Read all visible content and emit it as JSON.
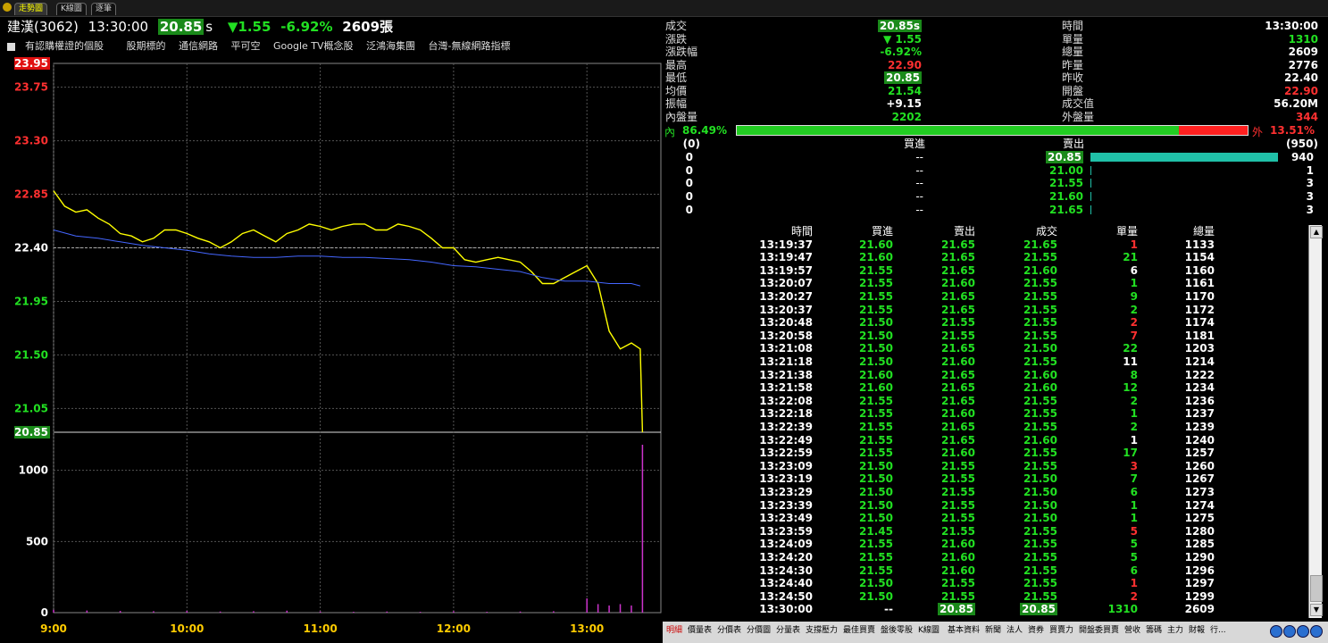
{
  "tabs": [
    "走勢圖",
    "K線圖",
    "逐筆"
  ],
  "header": {
    "stock_name": "建漢(3062)",
    "time": "13:30:00",
    "price": "20.85",
    "price_suffix": "s",
    "change": "▼1.55",
    "change_pct": "-6.92%",
    "volume": "2609張"
  },
  "concepts": [
    "有認購權證的個股",
    "股期標的",
    "通信網路",
    "平可空",
    "Google TV概念股",
    "泛鴻海集團",
    "台灣-無線網路指標"
  ],
  "chart_data": {
    "type": "line",
    "price_axis_ticks": [
      "23.95",
      "23.75",
      "23.30",
      "22.85",
      "22.40",
      "21.95",
      "21.50",
      "21.05",
      "20.85"
    ],
    "volume_axis_ticks": [
      "1000",
      "500",
      "0"
    ],
    "x_ticks": [
      "9:00",
      "10:00",
      "11:00",
      "12:00",
      "13:00"
    ],
    "ylim": [
      20.85,
      23.95
    ],
    "reference_price": 22.4,
    "current_price_line": 20.85,
    "series": [
      {
        "color": "#ffff00",
        "x": [
          "09:00",
          "09:05",
          "09:10",
          "09:15",
          "09:20",
          "09:25",
          "09:30",
          "09:35",
          "09:40",
          "09:45",
          "09:50",
          "09:55",
          "10:00",
          "10:05",
          "10:10",
          "10:15",
          "10:20",
          "10:25",
          "10:30",
          "10:35",
          "10:40",
          "10:45",
          "10:50",
          "10:55",
          "11:00",
          "11:05",
          "11:10",
          "11:15",
          "11:20",
          "11:25",
          "11:30",
          "11:35",
          "11:40",
          "11:45",
          "11:50",
          "11:55",
          "12:00",
          "12:05",
          "12:10",
          "12:15",
          "12:20",
          "12:25",
          "12:30",
          "12:35",
          "12:40",
          "12:45",
          "12:50",
          "12:55",
          "13:00",
          "13:05",
          "13:10",
          "13:15",
          "13:20",
          "13:24",
          "13:25"
        ],
        "values": [
          22.88,
          22.75,
          22.7,
          22.72,
          22.65,
          22.6,
          22.52,
          22.5,
          22.45,
          22.48,
          22.55,
          22.55,
          22.52,
          22.48,
          22.45,
          22.4,
          22.45,
          22.52,
          22.55,
          22.5,
          22.45,
          22.52,
          22.55,
          22.6,
          22.58,
          22.55,
          22.58,
          22.6,
          22.6,
          22.55,
          22.55,
          22.6,
          22.58,
          22.55,
          22.48,
          22.4,
          22.4,
          22.3,
          22.28,
          22.3,
          22.32,
          22.3,
          22.28,
          22.2,
          22.1,
          22.1,
          22.15,
          22.2,
          22.25,
          22.1,
          21.7,
          21.55,
          21.6,
          21.55,
          20.85
        ]
      },
      {
        "color": "#4466ff",
        "x": [
          "09:00",
          "09:10",
          "09:20",
          "09:30",
          "09:40",
          "09:50",
          "10:00",
          "10:10",
          "10:20",
          "10:30",
          "10:40",
          "10:50",
          "11:00",
          "11:10",
          "11:20",
          "11:30",
          "11:40",
          "11:50",
          "12:00",
          "12:10",
          "12:20",
          "12:30",
          "12:40",
          "12:50",
          "13:00",
          "13:10",
          "13:20",
          "13:24"
        ],
        "values": [
          22.55,
          22.5,
          22.48,
          22.45,
          22.42,
          22.4,
          22.38,
          22.35,
          22.33,
          22.32,
          22.32,
          22.33,
          22.33,
          22.32,
          22.32,
          22.31,
          22.3,
          22.28,
          22.25,
          22.24,
          22.22,
          22.2,
          22.15,
          22.12,
          22.12,
          22.1,
          22.1,
          22.08
        ]
      }
    ],
    "volume_bars": {
      "x": [
        "09:00",
        "09:15",
        "09:30",
        "09:45",
        "10:00",
        "10:15",
        "10:30",
        "10:45",
        "11:00",
        "11:15",
        "11:30",
        "11:45",
        "12:00",
        "12:15",
        "12:30",
        "12:45",
        "13:00",
        "13:05",
        "13:10",
        "13:15",
        "13:20",
        "13:25"
      ],
      "values": [
        20,
        15,
        12,
        10,
        12,
        8,
        10,
        14,
        8,
        6,
        8,
        6,
        10,
        6,
        8,
        10,
        100,
        60,
        50,
        60,
        50,
        1310
      ]
    }
  },
  "quote": {
    "left": [
      {
        "label": "成交",
        "value": "20.85s",
        "style": "box"
      },
      {
        "label": "漲跌",
        "value": "▼ 1.55",
        "style": "green"
      },
      {
        "label": "漲跌幅",
        "value": "-6.92%",
        "style": "green"
      },
      {
        "label": "最高",
        "value": "22.90",
        "style": "red"
      },
      {
        "label": "最低",
        "value": "20.85",
        "style": "box"
      },
      {
        "label": "均價",
        "value": "21.54",
        "style": "green"
      },
      {
        "label": "振幅",
        "value": "+9.15",
        "style": "white"
      },
      {
        "label": "內盤量",
        "value": "2202",
        "style": "green"
      }
    ],
    "right": [
      {
        "label": "時間",
        "value": "13:30:00",
        "style": "white"
      },
      {
        "label": "單量",
        "value": "1310",
        "style": "green"
      },
      {
        "label": "總量",
        "value": "2609",
        "style": "white"
      },
      {
        "label": "昨量",
        "value": "2776",
        "style": "white"
      },
      {
        "label": "昨收",
        "value": "22.40",
        "style": "white"
      },
      {
        "label": "開盤",
        "value": "22.90",
        "style": "red"
      },
      {
        "label": "成交值",
        "value": "56.20M",
        "style": "white"
      },
      {
        "label": "外盤量",
        "value": "344",
        "style": "red"
      }
    ],
    "inner_label": "內",
    "inner_pct": "86.49%",
    "inner_fraction": 0.8649,
    "outer_label": "外",
    "outer_pct": "13.51%"
  },
  "orderbook": {
    "bid_total": "(0)",
    "bid_header": "買進",
    "ask_header": "賣出",
    "ask_total": "(950)",
    "rows": [
      {
        "bid_vol": "0",
        "bid": "--",
        "ask": "20.85",
        "ask_vol": "940",
        "bar": 1.0,
        "highlight": true
      },
      {
        "bid_vol": "0",
        "bid": "--",
        "ask": "21.00",
        "ask_vol": "1",
        "bar": 0,
        "highlight": false
      },
      {
        "bid_vol": "0",
        "bid": "--",
        "ask": "21.55",
        "ask_vol": "3",
        "bar": 0.003,
        "highlight": false
      },
      {
        "bid_vol": "0",
        "bid": "--",
        "ask": "21.60",
        "ask_vol": "3",
        "bar": 0.003,
        "highlight": false
      },
      {
        "bid_vol": "0",
        "bid": "--",
        "ask": "21.65",
        "ask_vol": "3",
        "bar": 0.003,
        "highlight": false
      }
    ]
  },
  "ticks": {
    "headers": [
      "時間",
      "買進",
      "賣出",
      "成交",
      "單量",
      "總量"
    ],
    "rows": [
      [
        "13:19:37",
        "21.60",
        "21.65",
        "21.65",
        "1",
        "1133",
        "r"
      ],
      [
        "13:19:47",
        "21.60",
        "21.65",
        "21.55",
        "21",
        "1154",
        "g"
      ],
      [
        "13:19:57",
        "21.55",
        "21.65",
        "21.60",
        "6",
        "1160",
        "w"
      ],
      [
        "13:20:07",
        "21.55",
        "21.60",
        "21.55",
        "1",
        "1161",
        "g"
      ],
      [
        "13:20:27",
        "21.55",
        "21.65",
        "21.55",
        "9",
        "1170",
        "g"
      ],
      [
        "13:20:37",
        "21.55",
        "21.65",
        "21.55",
        "2",
        "1172",
        "g"
      ],
      [
        "13:20:48",
        "21.50",
        "21.55",
        "21.55",
        "2",
        "1174",
        "r"
      ],
      [
        "13:20:58",
        "21.50",
        "21.55",
        "21.55",
        "7",
        "1181",
        "r"
      ],
      [
        "13:21:08",
        "21.50",
        "21.65",
        "21.50",
        "22",
        "1203",
        "g"
      ],
      [
        "13:21:18",
        "21.50",
        "21.60",
        "21.55",
        "11",
        "1214",
        "w"
      ],
      [
        "13:21:38",
        "21.60",
        "21.65",
        "21.60",
        "8",
        "1222",
        "g"
      ],
      [
        "13:21:58",
        "21.60",
        "21.65",
        "21.60",
        "12",
        "1234",
        "g"
      ],
      [
        "13:22:08",
        "21.55",
        "21.65",
        "21.55",
        "2",
        "1236",
        "g"
      ],
      [
        "13:22:18",
        "21.55",
        "21.60",
        "21.55",
        "1",
        "1237",
        "g"
      ],
      [
        "13:22:39",
        "21.55",
        "21.65",
        "21.55",
        "2",
        "1239",
        "g"
      ],
      [
        "13:22:49",
        "21.55",
        "21.65",
        "21.60",
        "1",
        "1240",
        "w"
      ],
      [
        "13:22:59",
        "21.55",
        "21.60",
        "21.55",
        "17",
        "1257",
        "g"
      ],
      [
        "13:23:09",
        "21.50",
        "21.55",
        "21.55",
        "3",
        "1260",
        "r"
      ],
      [
        "13:23:19",
        "21.50",
        "21.55",
        "21.50",
        "7",
        "1267",
        "g"
      ],
      [
        "13:23:29",
        "21.50",
        "21.55",
        "21.50",
        "6",
        "1273",
        "g"
      ],
      [
        "13:23:39",
        "21.50",
        "21.55",
        "21.50",
        "1",
        "1274",
        "g"
      ],
      [
        "13:23:49",
        "21.50",
        "21.55",
        "21.50",
        "1",
        "1275",
        "g"
      ],
      [
        "13:23:59",
        "21.45",
        "21.55",
        "21.55",
        "5",
        "1280",
        "r"
      ],
      [
        "13:24:09",
        "21.55",
        "21.60",
        "21.55",
        "5",
        "1285",
        "g"
      ],
      [
        "13:24:20",
        "21.55",
        "21.60",
        "21.55",
        "5",
        "1290",
        "g"
      ],
      [
        "13:24:30",
        "21.55",
        "21.60",
        "21.55",
        "6",
        "1296",
        "g"
      ],
      [
        "13:24:40",
        "21.50",
        "21.55",
        "21.55",
        "1",
        "1297",
        "r"
      ],
      [
        "13:24:50",
        "21.50",
        "21.55",
        "21.55",
        "2",
        "1299",
        "r"
      ],
      [
        "13:30:00",
        "--",
        "20.85",
        "20.85",
        "1310",
        "2609",
        "last"
      ]
    ]
  },
  "bottom_tabs": [
    "明細",
    "價量表",
    "分價表",
    "分價圖",
    "分量表",
    "支撐壓力",
    "最佳買賣",
    "盤後零股",
    "K線圖",
    "基本資料",
    "新聞",
    "法人",
    "資券",
    "買賣力",
    "開盤委買賣",
    "營收",
    "籌碼",
    "主力",
    "財報",
    "行..."
  ],
  "colors": {
    "price_line": "#ffff00",
    "avg_line": "#4466ff",
    "volume_bar": "#cc33cc",
    "up": "#ff3030",
    "down": "#22e022",
    "ask_bar": "#20c0a8"
  }
}
